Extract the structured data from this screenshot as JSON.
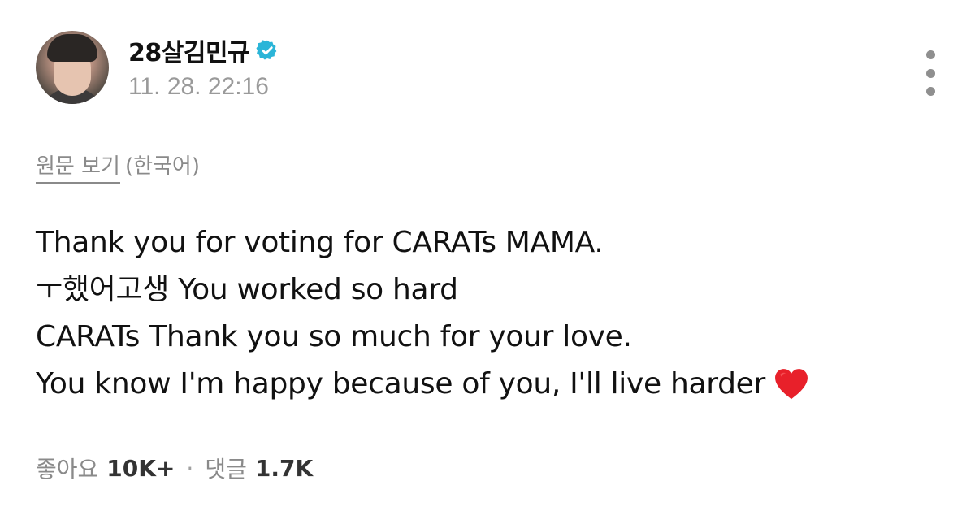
{
  "post": {
    "username": "28살김민규",
    "timestamp": "11. 28. 22:16",
    "verified_color": "#2bb5d8",
    "view_original_label": "원문 보기",
    "original_language": "(한국어)",
    "lines": [
      "Thank you for voting for CARATs MAMA.",
      "ㅜ했어고생 You worked so hard",
      "CARATs Thank you so much for your love.",
      "You know I'm happy because of you, I'll live harder"
    ],
    "emoji": "red-heart"
  },
  "stats": {
    "likes_label": "좋아요",
    "likes_count": "10K+",
    "separator": "·",
    "comments_label": "댓글",
    "comments_count": "1.7K"
  },
  "icons": {
    "more": "more-vertical-icon",
    "verified": "verified-badge-icon"
  }
}
